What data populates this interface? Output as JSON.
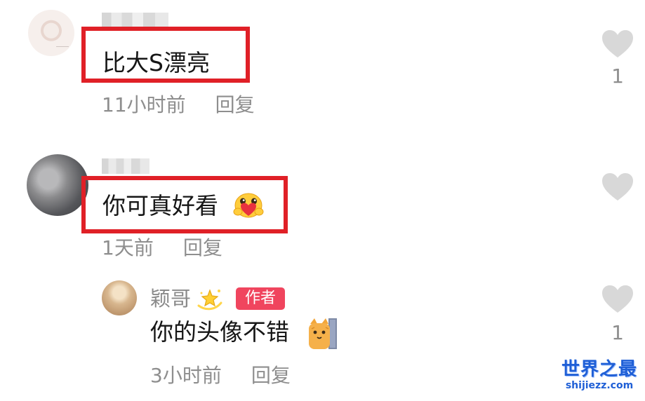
{
  "comments": [
    {
      "text": "比大S漂亮",
      "time": "11小时前",
      "reply_label": "回复",
      "like_count": "1"
    },
    {
      "text": "你可真好看",
      "emoji": "hugging-heart-emoji",
      "time": "1天前",
      "reply_label": "回复",
      "like_count": "",
      "replies": [
        {
          "author": "颖哥",
          "author_glyph": "sparkle-star-emoji",
          "badge": "作者",
          "text": "你的头像不错",
          "emoji": "cat-peeking-emoji",
          "time": "3小时前",
          "reply_label": "回复",
          "like_count": "1"
        }
      ]
    }
  ],
  "colors": {
    "highlight_border": "#e02027",
    "badge_bg": "#f0455e",
    "meta_text": "#8e8e8e",
    "heart": "#d8d8d8",
    "watermark": "#1f5fd6"
  },
  "icons": {
    "like": "heart-icon"
  },
  "watermark": {
    "title": "世界之最",
    "url": "shijiezz.com"
  }
}
